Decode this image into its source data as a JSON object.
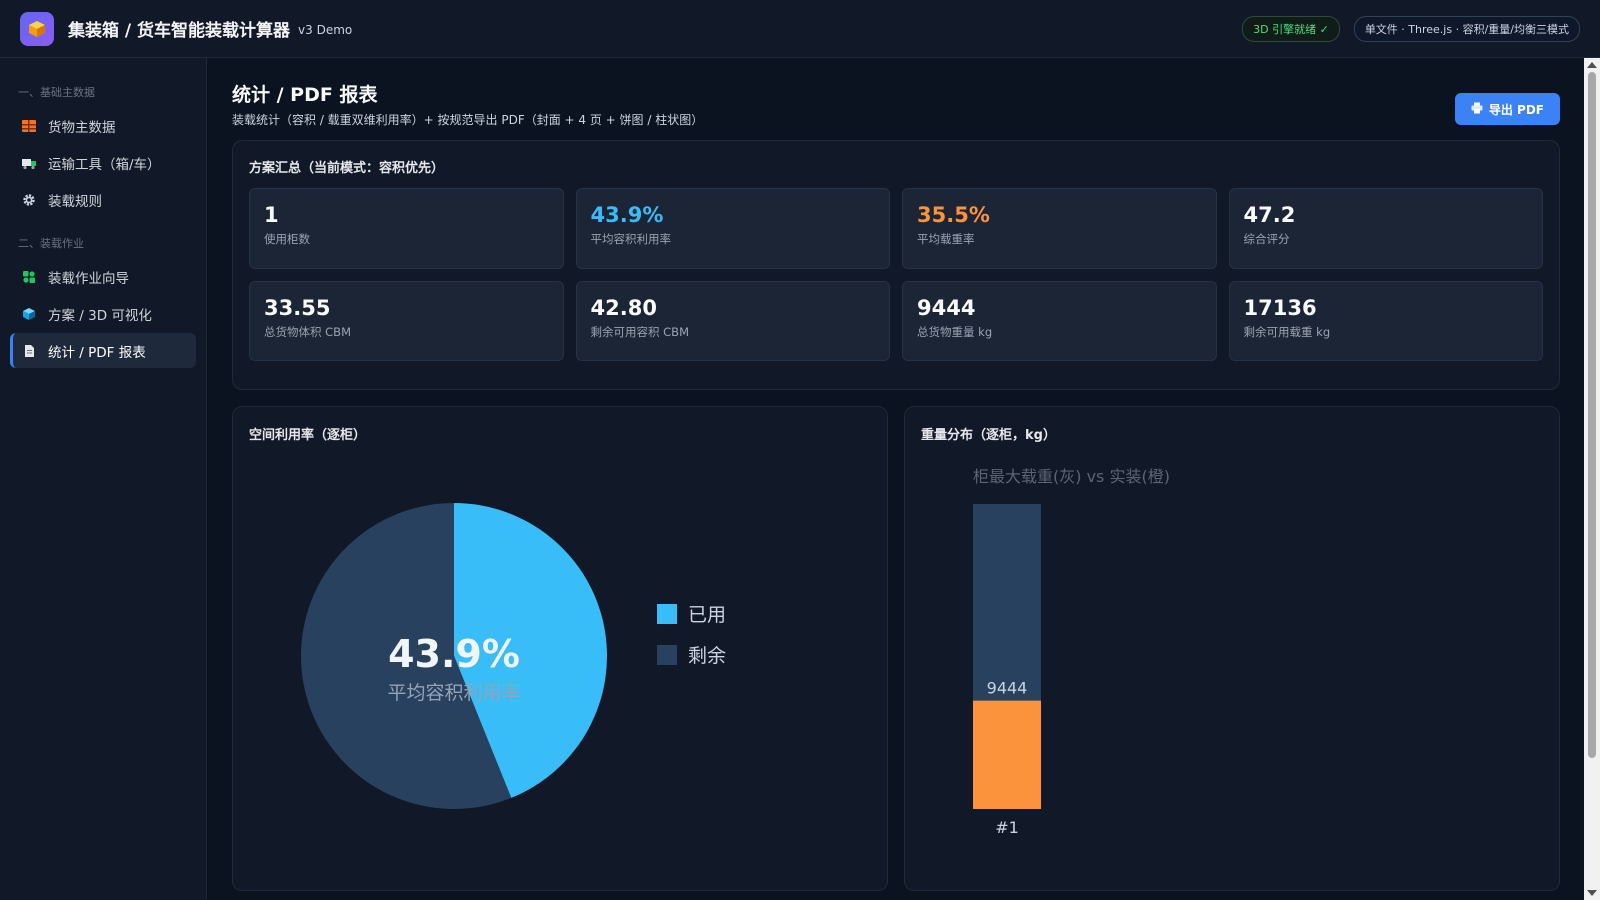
{
  "app": {
    "title": "集装箱 / 货车智能装载计算器",
    "version": "v3 Demo",
    "badge_engine": "3D 引擎就绪 ✓",
    "badge_info": "单文件 · Three.js · 容积/重量/均衡三模式"
  },
  "sidebar": {
    "section_basic": "一、基础主数据",
    "section_ops": "二、装载作业",
    "items": [
      {
        "label": "货物主数据",
        "icon": "cargo-icon"
      },
      {
        "label": "运输工具（箱/车）",
        "icon": "truck-icon"
      },
      {
        "label": "装载规则",
        "icon": "gear-icon"
      },
      {
        "label": "装载作业向导",
        "icon": "puzzle-icon"
      },
      {
        "label": "方案 / 3D 可视化",
        "icon": "cube-icon"
      },
      {
        "label": "统计 / PDF 报表",
        "icon": "document-icon",
        "active": true
      }
    ]
  },
  "page": {
    "title": "统计 / PDF 报表",
    "subtitle": "装载统计（容积 / 载重双维利用率）+ 按规范导出 PDF（封面 + 4 页 + 饼图 / 柱状图）",
    "export_label": "导出 PDF"
  },
  "summary": {
    "title": "方案汇总（当前模式：容积优先）",
    "kpis": [
      {
        "value": "1",
        "label": "使用柜数",
        "color": "#f9fafb"
      },
      {
        "value": "43.9%",
        "label": "平均容积利用率",
        "color": "#38bdf8"
      },
      {
        "value": "35.5%",
        "label": "平均载重率",
        "color": "#fb923c"
      },
      {
        "value": "47.2",
        "label": "综合评分",
        "color": "#f9fafb"
      },
      {
        "value": "33.55",
        "label": "总货物体积 CBM",
        "color": "#f9fafb"
      },
      {
        "value": "42.80",
        "label": "剩余可用容积 CBM",
        "color": "#f9fafb"
      },
      {
        "value": "9444",
        "label": "总货物重量 kg",
        "color": "#f9fafb"
      },
      {
        "value": "17136",
        "label": "剩余可用载重 kg",
        "color": "#f9fafb"
      }
    ]
  },
  "chart_data": [
    {
      "type": "pie",
      "title": "空间利用率（逐柜）",
      "center_value": "43.9%",
      "center_label": "平均容积利用率",
      "slices": [
        {
          "name": "已用",
          "value": 43.9,
          "color": "#38bdf8"
        },
        {
          "name": "剩余",
          "value": 56.1,
          "color": "#27415f"
        }
      ]
    },
    {
      "type": "bar",
      "title": "重量分布（逐柜，kg）",
      "subtitle": "柜最大载重(灰) vs 实装(橙)",
      "categories": [
        "#1"
      ],
      "series": [
        {
          "name": "柜最大载重",
          "values": [
            26580
          ],
          "color": "#27415f"
        },
        {
          "name": "实装",
          "values": [
            9444
          ],
          "color": "#fb923c"
        }
      ],
      "value_labels": [
        "9444"
      ]
    }
  ]
}
